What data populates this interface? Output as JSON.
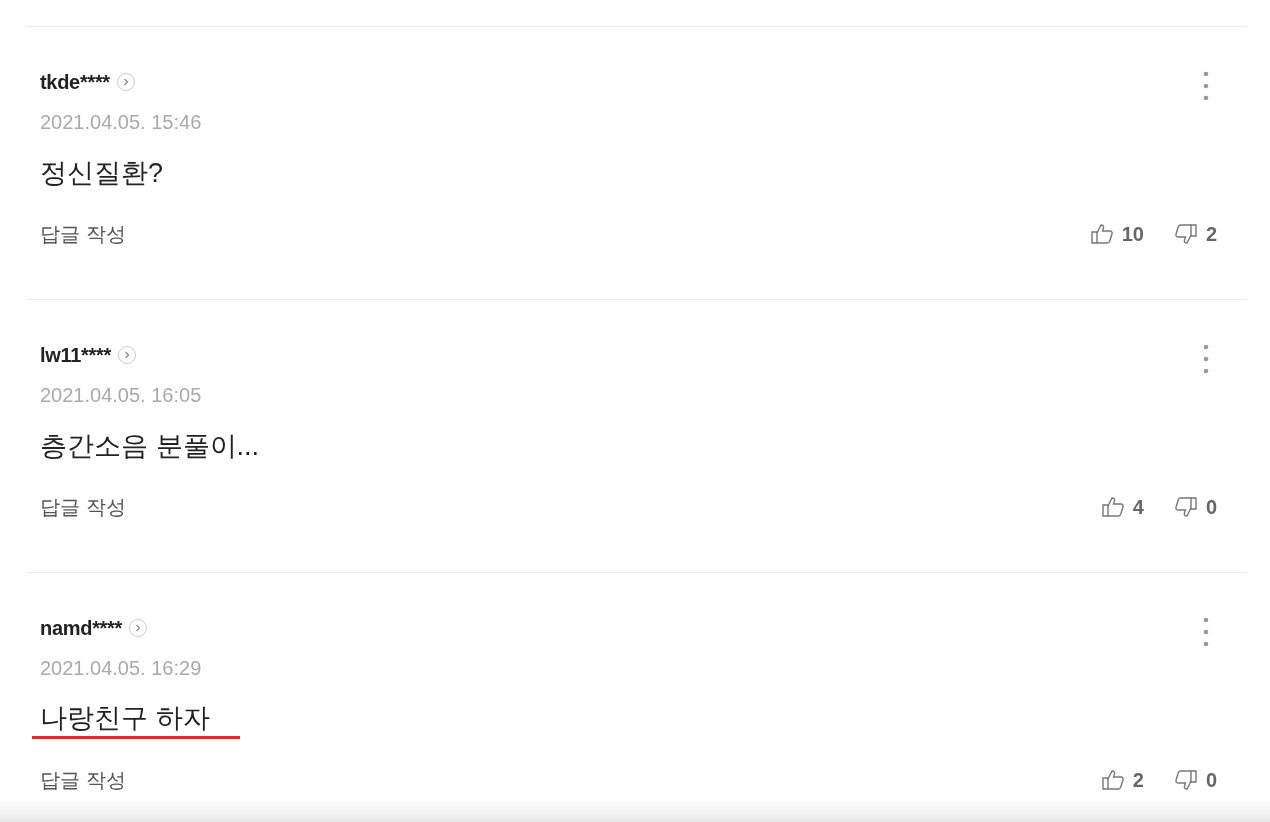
{
  "comments": [
    {
      "user": "tkde****",
      "date": "2021.04.05. 15:46",
      "text": "정신질환?",
      "underlined": false,
      "reply_label": "답글 작성",
      "likes": "10",
      "dislikes": "2"
    },
    {
      "user": "lw11****",
      "date": "2021.04.05. 16:05",
      "text": "층간소음 분풀이...",
      "underlined": false,
      "reply_label": "답글 작성",
      "likes": "4",
      "dislikes": "0"
    },
    {
      "user": "namd****",
      "date": "2021.04.05. 16:29",
      "text": "나랑친구 하자",
      "underlined": true,
      "reply_label": "답글 작성",
      "likes": "2",
      "dislikes": "0"
    }
  ]
}
